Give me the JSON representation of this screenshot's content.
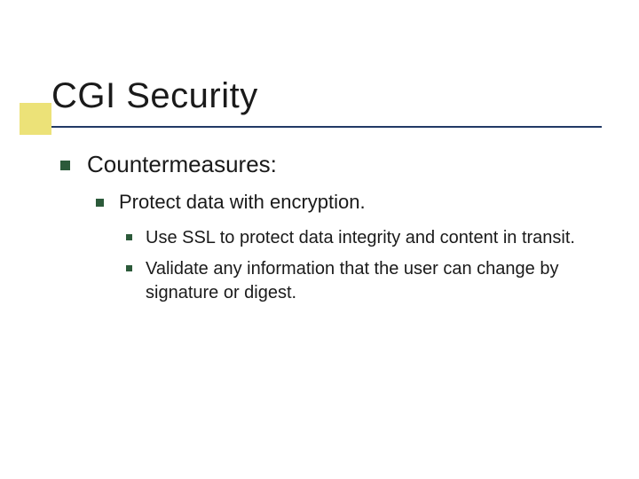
{
  "title": "CGI Security",
  "bullets": {
    "lvl1": "Countermeasures:",
    "lvl2": "Protect data with encryption.",
    "lvl3a": "Use SSL to protect data integrity and content in transit.",
    "lvl3b": "Validate any information that the user can change by signature or digest."
  }
}
